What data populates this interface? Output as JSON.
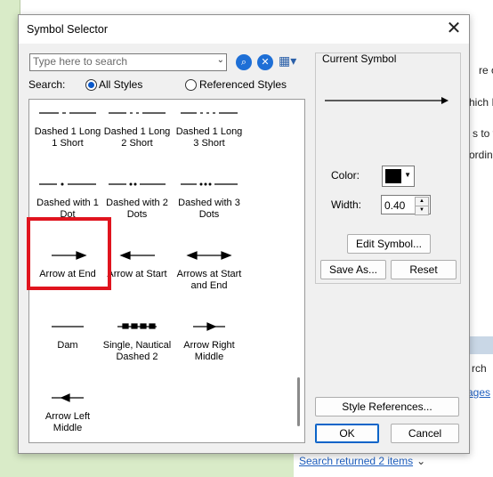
{
  "dialog": {
    "title": "Symbol Selector",
    "close_glyph": "✕"
  },
  "search": {
    "placeholder": "Type here to search",
    "scope_label": "Search:",
    "all_styles": "All Styles",
    "referenced_styles": "Referenced Styles"
  },
  "symbols": [
    {
      "caption": "Dashed 1 Long\n1 Short"
    },
    {
      "caption": "Dashed 1 Long\n2 Short"
    },
    {
      "caption": "Dashed 1 Long\n3 Short"
    },
    {
      "caption": "Dashed with 1\nDot"
    },
    {
      "caption": "Dashed with 2\nDots"
    },
    {
      "caption": "Dashed with 3\nDots"
    },
    {
      "caption": "Arrow at End"
    },
    {
      "caption": "Arrow at Start"
    },
    {
      "caption": "Arrows at Start\nand End"
    },
    {
      "caption": "Dam"
    },
    {
      "caption": "Single, Nautical\nDashed 2"
    },
    {
      "caption": "Arrow Right\nMiddle"
    },
    {
      "caption": "Arrow Left\nMiddle"
    }
  ],
  "current": {
    "title": "Current Symbol",
    "color_label": "Color:",
    "color_value": "#000000",
    "width_label": "Width:",
    "width_value": "0.40"
  },
  "buttons": {
    "edit_symbol": "Edit Symbol...",
    "save_as": "Save As...",
    "reset": "Reset",
    "style_references": "Style References...",
    "ok": "OK",
    "cancel": "Cancel"
  },
  "background": {
    "right_lines": [
      "re or",
      "hich I",
      "s to t",
      "ordin"
    ],
    "right_search": "rch",
    "right_link": "ages",
    "search_returned": "Search returned 2 items"
  }
}
